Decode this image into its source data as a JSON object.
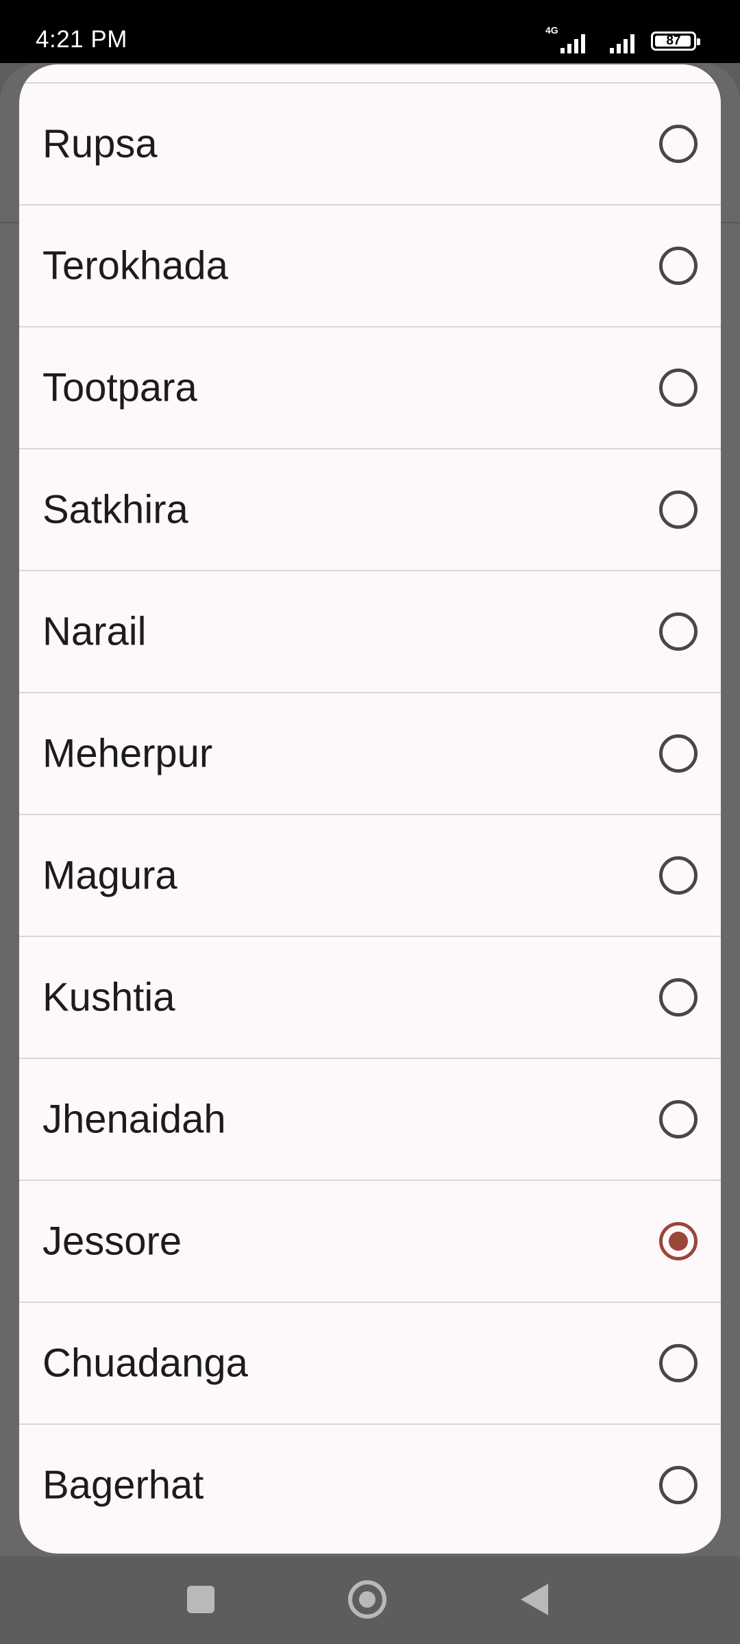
{
  "status_bar": {
    "time": "4:21 PM",
    "network_type": "4G",
    "battery_level": "87",
    "icons": [
      "signal-4g-icon",
      "signal-icon",
      "battery-icon"
    ]
  },
  "dialog": {
    "options": [
      {
        "label": "Rupsa",
        "selected": false
      },
      {
        "label": "Terokhada",
        "selected": false
      },
      {
        "label": "Tootpara",
        "selected": false
      },
      {
        "label": "Satkhira",
        "selected": false
      },
      {
        "label": "Narail",
        "selected": false
      },
      {
        "label": "Meherpur",
        "selected": false
      },
      {
        "label": "Magura",
        "selected": false
      },
      {
        "label": "Kushtia",
        "selected": false
      },
      {
        "label": "Jhenaidah",
        "selected": false
      },
      {
        "label": "Jessore",
        "selected": true
      },
      {
        "label": "Chuadanga",
        "selected": false
      },
      {
        "label": "Bagerhat",
        "selected": false
      }
    ]
  },
  "nav_bar": {
    "icons": [
      "recents-icon",
      "home-icon",
      "back-icon"
    ]
  },
  "colors": {
    "accent": "#9a4638",
    "dialog_background": "#fdf8fb",
    "scrim": "#5d5d5d"
  }
}
